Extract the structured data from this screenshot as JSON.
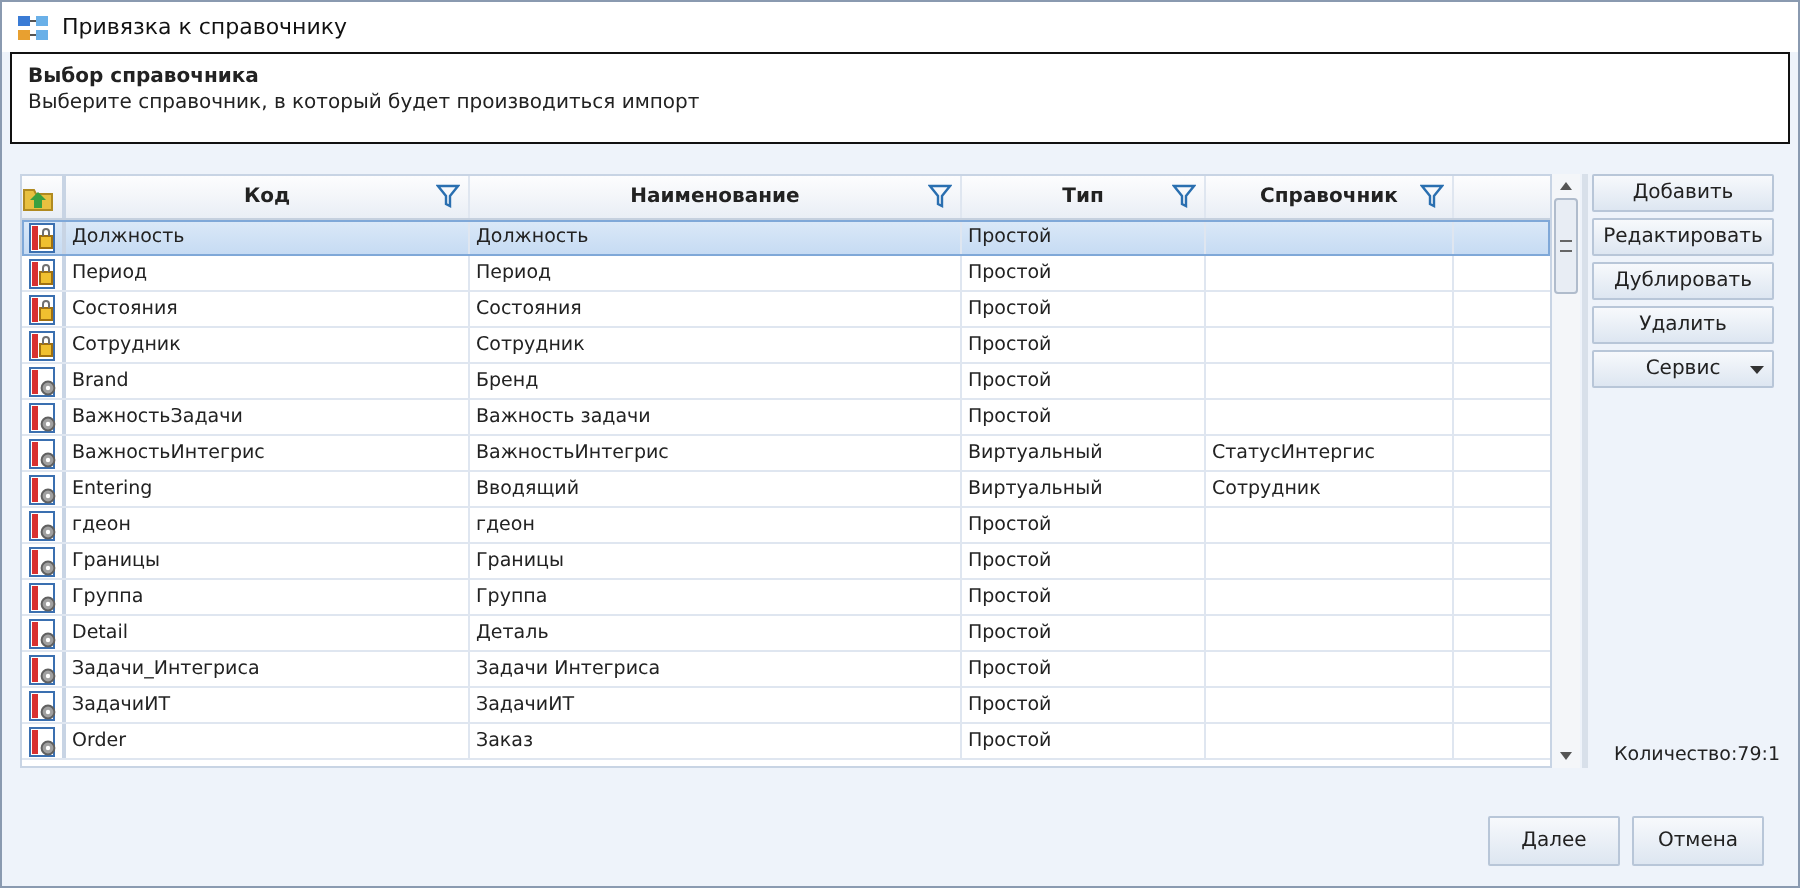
{
  "window": {
    "title": "Привязка к справочнику"
  },
  "header": {
    "title": "Выбор справочника",
    "subtitle": "Выберите справочник, в который будет производиться импорт"
  },
  "table": {
    "columns": [
      {
        "label": "Код",
        "filter": true
      },
      {
        "label": "Наименование",
        "filter": true
      },
      {
        "label": "Тип",
        "filter": true
      },
      {
        "label": "Справочник",
        "filter": true
      }
    ],
    "rows": [
      {
        "kind": "locked",
        "selected": true,
        "cells": [
          "Должность",
          "Должность",
          "Простой",
          ""
        ]
      },
      {
        "kind": "locked",
        "selected": false,
        "cells": [
          "Период",
          "Период",
          "Простой",
          ""
        ]
      },
      {
        "kind": "locked",
        "selected": false,
        "cells": [
          "Состояния",
          "Состояния",
          "Простой",
          ""
        ]
      },
      {
        "kind": "locked",
        "selected": false,
        "cells": [
          "Сотрудник",
          "Сотрудник",
          "Простой",
          ""
        ]
      },
      {
        "kind": "gear",
        "selected": false,
        "cells": [
          "Brand",
          "Бренд",
          "Простой",
          ""
        ]
      },
      {
        "kind": "gear",
        "selected": false,
        "cells": [
          "ВажностьЗадачи",
          "Важность задачи",
          "Простой",
          ""
        ]
      },
      {
        "kind": "gear",
        "selected": false,
        "cells": [
          "ВажностьИнтегрис",
          "ВажностьИнтегрис",
          "Виртуальный",
          "СтатусИнтергис"
        ]
      },
      {
        "kind": "gear",
        "selected": false,
        "cells": [
          "Entering",
          "Вводящий",
          "Виртуальный",
          "Сотрудник"
        ]
      },
      {
        "kind": "gear",
        "selected": false,
        "cells": [
          "гдеон",
          "гдеон",
          "Простой",
          ""
        ]
      },
      {
        "kind": "gear",
        "selected": false,
        "cells": [
          "Границы",
          "Границы",
          "Простой",
          ""
        ]
      },
      {
        "kind": "gear",
        "selected": false,
        "cells": [
          "Группа",
          "Группа",
          "Простой",
          ""
        ]
      },
      {
        "kind": "gear",
        "selected": false,
        "cells": [
          "Detail",
          "Деталь",
          "Простой",
          ""
        ]
      },
      {
        "kind": "gear",
        "selected": false,
        "cells": [
          "Задачи_Интегриса",
          "Задачи Интегриса",
          "Простой",
          ""
        ]
      },
      {
        "kind": "gear",
        "selected": false,
        "cells": [
          "ЗадачиИТ",
          "ЗадачиИТ",
          "Простой",
          ""
        ]
      },
      {
        "kind": "gear",
        "selected": false,
        "cells": [
          "Order",
          "Заказ",
          "Простой",
          ""
        ]
      }
    ]
  },
  "side_buttons": [
    {
      "label": "Добавить",
      "kind": "plain"
    },
    {
      "label": "Редактировать",
      "kind": "plain"
    },
    {
      "label": "Дублировать",
      "kind": "plain"
    },
    {
      "label": "Удалить",
      "kind": "plain"
    },
    {
      "label": "Сервис",
      "kind": "dropdown"
    }
  ],
  "count": "Количество:79:1",
  "footer_buttons": [
    "Далее",
    "Отмена"
  ]
}
